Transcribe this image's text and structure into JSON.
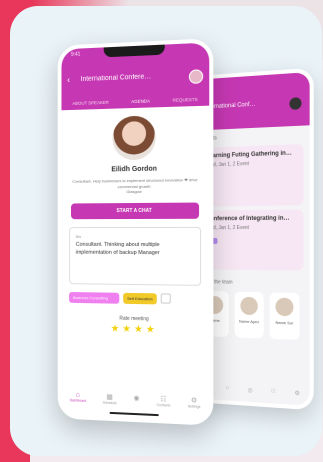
{
  "back_phone": {
    "header_title": "International Conf…",
    "section_label": "Events",
    "items": [
      {
        "title": "Learning Futing Gathering in…",
        "sub": "Wed, Jan 1, 2 Event"
      },
      {
        "title": "Conference of Integrating in…",
        "sub": "Wed, Jan 1, 2 Event"
      }
    ],
    "people_label": "Meet the team",
    "people": [
      {
        "name": "Name"
      },
      {
        "name": "Name Apex"
      },
      {
        "name": "Name Sur"
      }
    ],
    "nav": [
      "⌂",
      "○",
      "◎",
      "□",
      "⚙"
    ]
  },
  "phone": {
    "status_time": "9:41",
    "header_title": "International Confere…",
    "tabs": [
      "ABOUT SPEAKER",
      "AGENDA",
      "REQUESTS"
    ],
    "profile": {
      "name": "Eilidh Gordon",
      "description": "Consultant. Help businesses to implement structured innovation ❤ drive commercial growth",
      "location": "Glasgow"
    },
    "start_chat_label": "START A CHAT",
    "bio_label": "Bio",
    "bio_text": "Consultant. Thinking about multiple implementation of backup Manager",
    "tags": [
      "Business Consulting",
      "Self Education"
    ],
    "rating_label": "Rate meeting",
    "stars": "★★★★",
    "nav": [
      {
        "icon": "⌂",
        "label": "Dashboard"
      },
      {
        "icon": "▦",
        "label": "Schedule"
      },
      {
        "icon": "◉",
        "label": ""
      },
      {
        "icon": "☷",
        "label": "Contacts"
      },
      {
        "icon": "⚙",
        "label": "Settings"
      }
    ]
  },
  "colors": {
    "brand": "#c637b3",
    "accent_red": "#e8375a",
    "star": "#f4d20f"
  }
}
